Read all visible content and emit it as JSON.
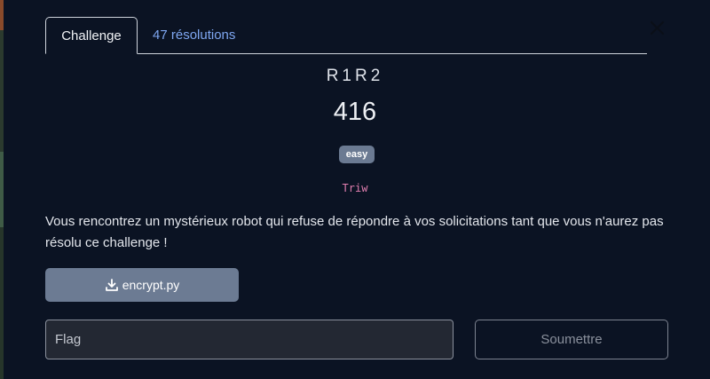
{
  "tabs": {
    "challenge_label": "Challenge",
    "solves_label": "47 résolutions"
  },
  "challenge": {
    "name": "R1R2",
    "points": "416",
    "difficulty": "easy",
    "author": "Triw",
    "description": "Vous rencontrez un mystérieux robot qui refuse de répondre à vos solicitations tant que vous n'aurez pas résolu ce challenge !"
  },
  "files": [
    {
      "name": "encrypt.py",
      "icon": "download-icon"
    }
  ],
  "flag": {
    "placeholder": "Flag",
    "value": ""
  },
  "submit_label": "Soumettre",
  "colors": {
    "background": "#0b1323",
    "link": "#7ea6f0",
    "badge": "#6b7a92",
    "author": "#e27fb0",
    "file_button": "#6c7b93"
  },
  "icons": {
    "close": "close-icon",
    "download": "download-icon"
  }
}
